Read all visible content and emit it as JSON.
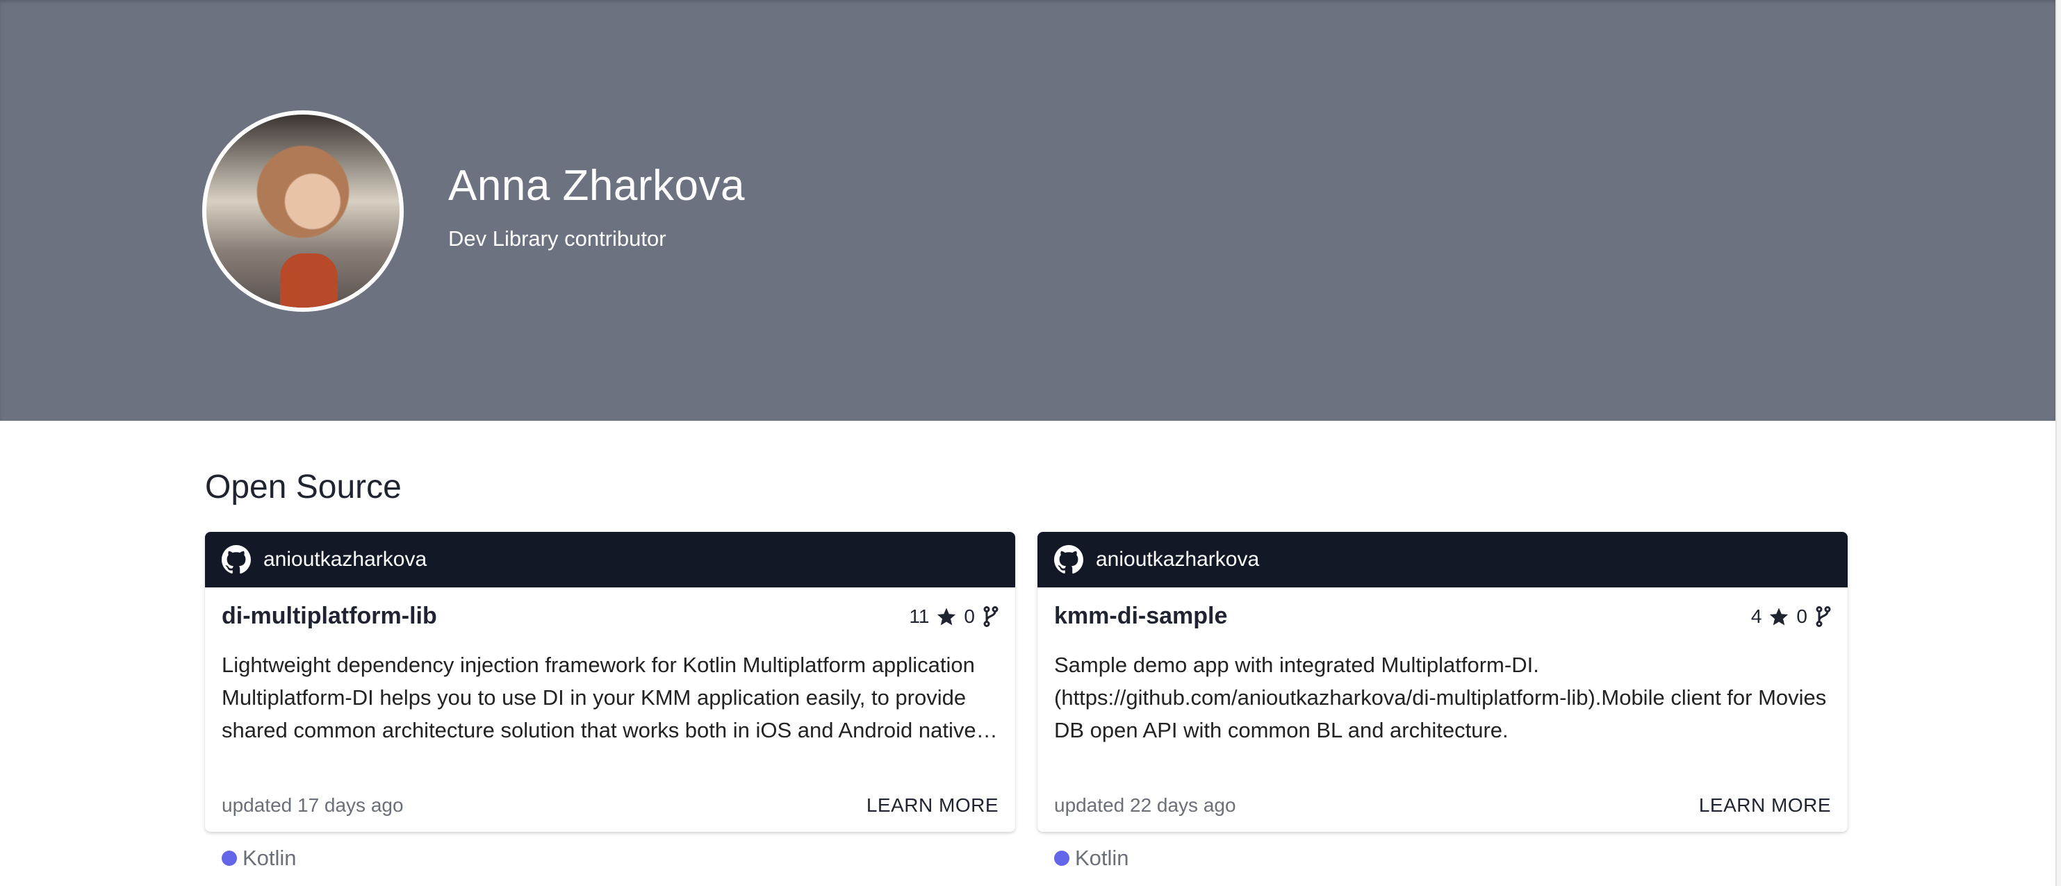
{
  "profile": {
    "name": "Anna Zharkova",
    "subtitle": "Dev Library contributor"
  },
  "section_title": "Open Source",
  "colors": {
    "hero": "#6c7280",
    "card_header": "#131826",
    "kotlin": "#6366e8"
  },
  "cards": [
    {
      "owner": "anioutkazharkova",
      "owner_icon": "github-icon",
      "title": "di-multiplatform-lib",
      "stars": "11",
      "forks": "0",
      "description": "Lightweight dependency injection framework for Kotlin Multiplatform application Multiplatform-DI helps you to use DI in your KMM application easily, to provide shared common architecture solution that works both in iOS and Android native applications.",
      "updated": "updated 17 days ago",
      "action": "LEARN MORE",
      "language": "Kotlin"
    },
    {
      "owner": "anioutkazharkova",
      "owner_icon": "github-icon",
      "title": "kmm-di-sample",
      "stars": "4",
      "forks": "0",
      "description": "Sample demo app with integrated Multiplatform-DI. (https://github.com/anioutkazharkova/di-multiplatform-lib).Mobile client for Movies DB open API with common BL and architecture.",
      "updated": "updated 22 days ago",
      "action": "LEARN MORE",
      "language": "Kotlin"
    }
  ]
}
